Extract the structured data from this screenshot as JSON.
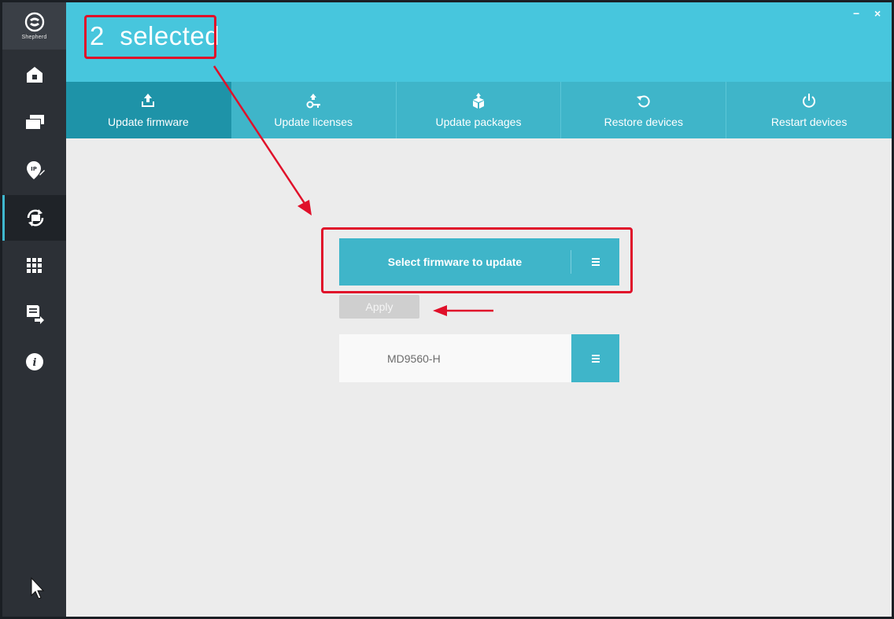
{
  "app": {
    "logo_text": "Shepherd"
  },
  "header": {
    "selected_count": "2",
    "selected_word": "selected",
    "minimize_label": "−",
    "close_label": "×"
  },
  "sidebar": {
    "items": [
      {
        "icon": "home-icon"
      },
      {
        "icon": "devices-icon"
      },
      {
        "icon": "ip-icon"
      },
      {
        "icon": "update-icon",
        "active": true
      },
      {
        "icon": "grid-icon"
      },
      {
        "icon": "export-icon"
      },
      {
        "icon": "info-icon"
      }
    ]
  },
  "tabs": [
    {
      "label": "Update firmware",
      "icon": "upload-icon",
      "active": true
    },
    {
      "label": "Update licenses",
      "icon": "license-icon"
    },
    {
      "label": "Update packages",
      "icon": "package-icon"
    },
    {
      "label": "Restore devices",
      "icon": "restore-icon"
    },
    {
      "label": "Restart devices",
      "icon": "power-icon"
    }
  ],
  "firmware": {
    "select_label": "Select firmware to update",
    "apply_label": "Apply"
  },
  "devices": [
    {
      "name": "MD9560-H"
    }
  ],
  "colors": {
    "accent": "#47c6dd",
    "tab_active": "#1e93a8",
    "sidebar": "#2c3036",
    "annotation": "#e0102a"
  }
}
